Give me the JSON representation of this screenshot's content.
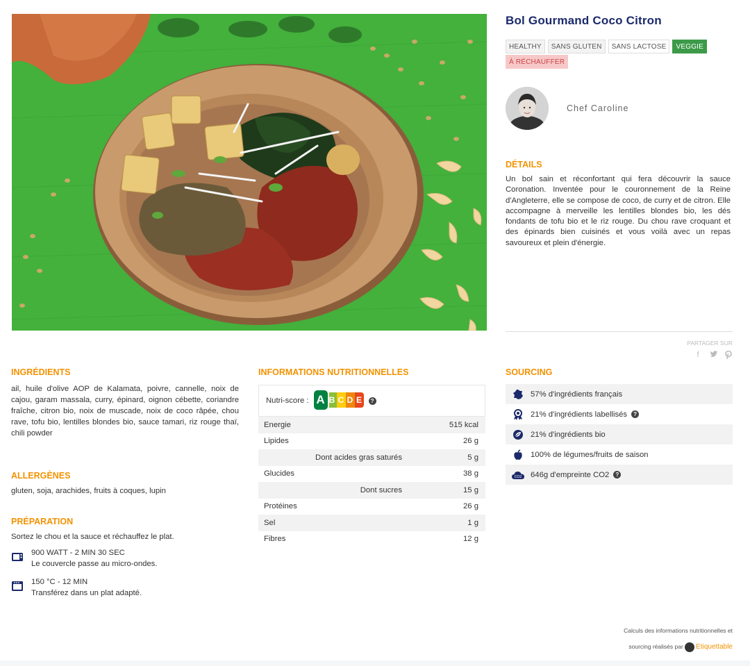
{
  "product": {
    "title": "Bol Gourmand Coco Citron",
    "tags": [
      "HEALTHY",
      "SANS GLUTEN",
      "SANS LACTOSE",
      "VEGGIE",
      "À RÉCHAUFFER"
    ],
    "chef_name": "Chef Caroline"
  },
  "details": {
    "heading": "DÉTAILS",
    "text": "Un bol sain et réconfortant qui fera découvrir la sauce Coronation. Inventée pour le couronnement de la Reine d'Angleterre, elle se compose de coco, de curry et de citron. Elle accompagne à merveille les lentilles blondes bio, les dés fondants de tofu bio et le riz rouge. Du chou rave croquant et des épinards bien cuisinés et vous voilà avec un repas savoureux et plein d'énergie."
  },
  "share": {
    "label": "PARTAGER SUR",
    "icons": [
      "facebook-icon",
      "twitter-icon",
      "pinterest-icon"
    ]
  },
  "ingredients": {
    "heading": "INGRÉDIENTS",
    "text": "ail, huile d'olive AOP de Kalamata, poivre, cannelle, noix de cajou, garam massala, curry, épinard, oignon cébette, coriandre fraîche, citron bio, noix de muscade, noix de coco râpée, chou rave, tofu bio, lentilles blondes bio, sauce tamari, riz rouge thaï, chili powder"
  },
  "allergens": {
    "heading": "ALLERGÈNES",
    "text": "gluten, soja, arachides, fruits à coques, lupin"
  },
  "preparation": {
    "heading": "PRÉPARATION",
    "intro": "Sortez le chou et la sauce et réchauffez le plat.",
    "steps": [
      {
        "icon": "microwave-icon",
        "line1": "900 WATT - 2 MIN 30 SEC",
        "line2": "Le couvercle passe au micro-ondes."
      },
      {
        "icon": "oven-icon",
        "line1": "150 °C - 12 MIN",
        "line2": "Transférez dans un plat adapté."
      }
    ]
  },
  "nutrition": {
    "heading": "INFORMATIONS NUTRITIONNELLES",
    "nutriscore_label": "Nutri-score :",
    "nutriscore_letters": [
      "A",
      "B",
      "C",
      "D",
      "E"
    ],
    "nutriscore_selected": "A",
    "rows": [
      {
        "label": "Energie",
        "value": "515 kcal"
      },
      {
        "label": "Lipides",
        "value": "26 g"
      },
      {
        "label": "Dont acides gras saturés",
        "value": "5 g"
      },
      {
        "label": "Glucides",
        "value": "38 g"
      },
      {
        "label": "Dont sucres",
        "value": "15 g"
      },
      {
        "label": "Protéines",
        "value": "26 g"
      },
      {
        "label": "Sel",
        "value": "1 g"
      },
      {
        "label": "Fibres",
        "value": "12 g"
      }
    ]
  },
  "sourcing": {
    "heading": "SOURCING",
    "items": [
      {
        "icon": "france-icon",
        "text": "57% d'ingrédients français"
      },
      {
        "icon": "label-medal-icon",
        "text": "21% d'ingrédients labellisés"
      },
      {
        "icon": "bio-leaf-icon",
        "text": "21% d'ingrédients bio"
      },
      {
        "icon": "apple-icon",
        "text": "100% de légumes/fruits de saison"
      },
      {
        "icon": "co2-cloud-icon",
        "text": "646g d'empreinte CO2"
      }
    ]
  },
  "credit": {
    "line1": "Calculs des informations nutritionnelles et",
    "line2": "sourcing réalisés par",
    "brand": "Etiquettable"
  },
  "colors": {
    "title": "#1b2a6b",
    "accent": "#f39200",
    "veggie_tag": "#3c9a48",
    "reheat_tag": "#f7c8c8",
    "hero_background": "#3fae3a"
  }
}
